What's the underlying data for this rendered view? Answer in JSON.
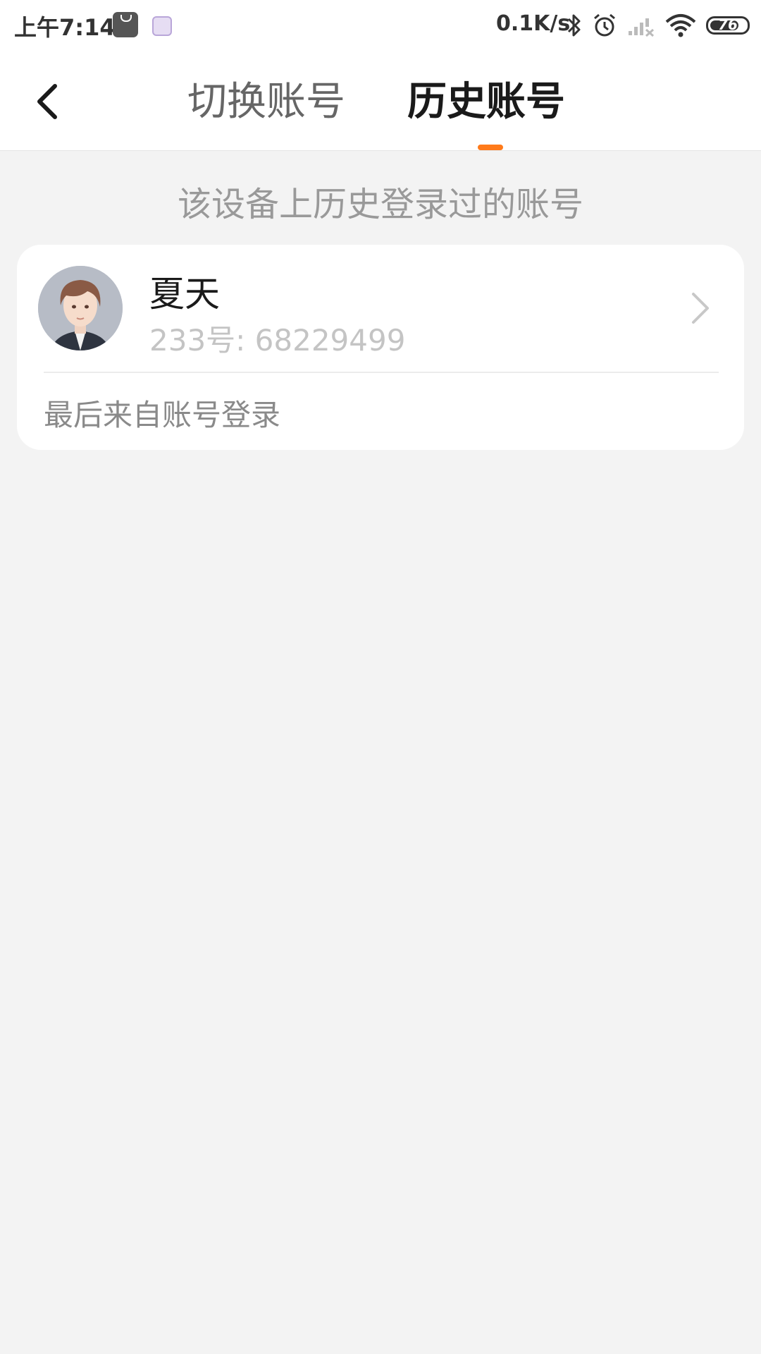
{
  "status_bar": {
    "time": "上午7:14",
    "network_speed": "0.1K/s",
    "battery_level": "76",
    "battery_percent": 76,
    "icons": [
      "mi-store-icon",
      "app-notification-icon",
      "bluetooth-icon",
      "alarm-icon",
      "signal-icon",
      "wifi-icon",
      "battery-icon"
    ]
  },
  "header": {
    "tabs": [
      {
        "label": "切换账号",
        "active": false
      },
      {
        "label": "历史账号",
        "active": true
      }
    ],
    "accent_color": "#ff7a1a"
  },
  "hint": "该设备上历史登录过的账号",
  "account": {
    "name": "夏天",
    "id_text": "233号: 68229499",
    "last_login": "最后来自账号登录"
  }
}
